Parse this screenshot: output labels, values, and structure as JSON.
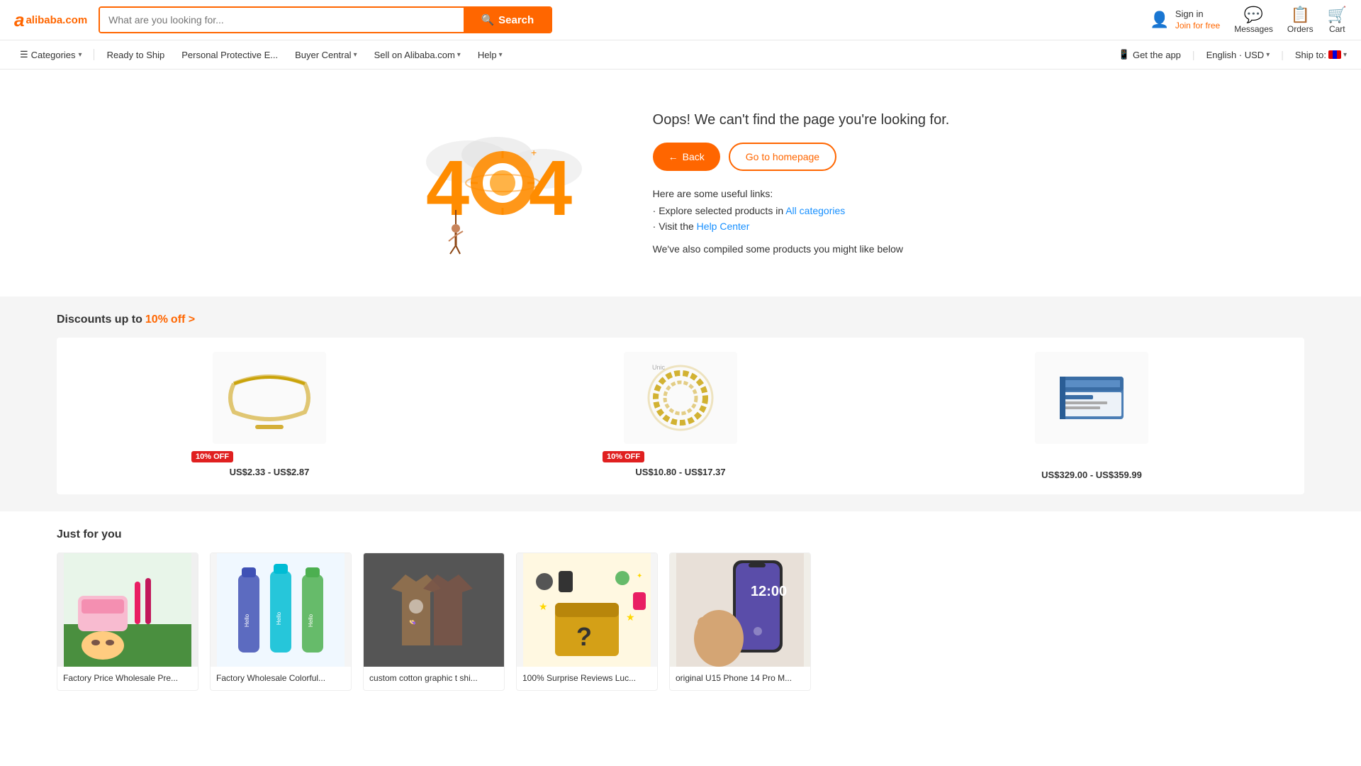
{
  "header": {
    "logo_text": "alibaba.com",
    "search_placeholder": "What are you looking for...",
    "search_btn_label": "Search",
    "actions": [
      {
        "icon": "👤",
        "label": "Sign in",
        "sublabel": "Join for free",
        "name": "sign-in"
      },
      {
        "icon": "💬",
        "label": "Messages",
        "sublabel": "",
        "name": "messages"
      },
      {
        "icon": "📋",
        "label": "Orders",
        "sublabel": "",
        "name": "orders"
      },
      {
        "icon": "🛒",
        "label": "Cart",
        "sublabel": "",
        "name": "cart"
      }
    ]
  },
  "nav": {
    "items": [
      {
        "label": "Categories",
        "has_dropdown": true,
        "name": "categories"
      },
      {
        "label": "Ready to Ship",
        "has_dropdown": false,
        "name": "ready-to-ship"
      },
      {
        "label": "Personal Protective E...",
        "has_dropdown": false,
        "name": "personal-protective"
      },
      {
        "label": "Buyer Central",
        "has_dropdown": true,
        "name": "buyer-central"
      },
      {
        "label": "Sell on Alibaba.com",
        "has_dropdown": true,
        "name": "sell-on-alibaba"
      },
      {
        "label": "Help",
        "has_dropdown": true,
        "name": "help"
      }
    ],
    "right": [
      {
        "label": "Get the app",
        "name": "get-app"
      },
      {
        "label": "English · USD",
        "name": "language"
      },
      {
        "label": "Ship to:",
        "name": "ship-to"
      }
    ]
  },
  "error_page": {
    "title": "Oops! We can't find the page you're looking for.",
    "back_btn": "Back",
    "homepage_btn": "Go to homepage",
    "useful_links_title": "Here are some useful links:",
    "link1_prefix": "· Explore selected products in ",
    "link1_text": "All categories",
    "link2_prefix": "· Visit the ",
    "link2_text": "Help Center",
    "compiled_msg": "We've also compiled some products you might like below"
  },
  "discounts": {
    "title": "Discounts up to",
    "percent": "10%",
    "off_text": "off >",
    "products": [
      {
        "badge": "10% OFF",
        "price": "US$2.33 - US$2.87",
        "name": "gold-chain-necklace",
        "has_badge": true
      },
      {
        "badge": "10% OFF",
        "price": "US$10.80 - US$17.37",
        "name": "pearl-bracelet",
        "has_badge": true
      },
      {
        "badge": "",
        "price": "US$329.00 - US$359.99",
        "name": "medication-box",
        "has_badge": false
      }
    ]
  },
  "just_for_you": {
    "title": "Just for you",
    "products": [
      {
        "label": "Factory Price Wholesale Pre..."
      },
      {
        "label": "Factory Wholesale Colorful..."
      },
      {
        "label": "custom cotton graphic t shi..."
      },
      {
        "label": "100% Surprise Reviews Luc..."
      },
      {
        "label": "original U15 Phone 14 Pro M..."
      }
    ]
  }
}
